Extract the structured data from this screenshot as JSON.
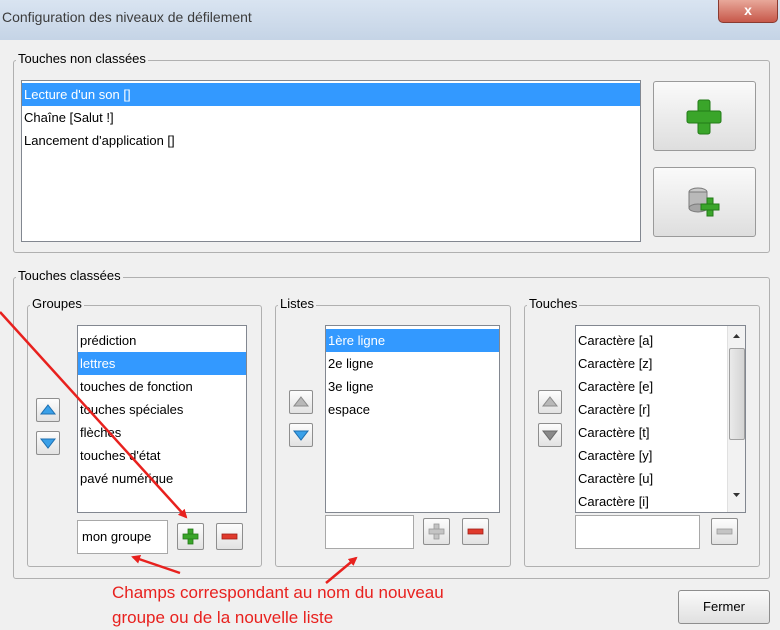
{
  "window": {
    "title": "Configuration des niveaux de défilement",
    "close_label": "x"
  },
  "unclassified": {
    "label": "Touches non classées",
    "items": [
      {
        "label": "Lecture d'un son []",
        "selected": true
      },
      {
        "label": "Chaîne [Salut !]",
        "selected": false
      },
      {
        "label": "Lancement d'application []",
        "selected": false
      }
    ],
    "buttons": [
      {
        "icon": "green-plus-icon"
      },
      {
        "icon": "database-add-icon"
      }
    ]
  },
  "classified": {
    "label": "Touches classées",
    "groupes": {
      "label": "Groupes",
      "items": [
        {
          "label": "prédiction",
          "selected": false
        },
        {
          "label": "lettres",
          "selected": true
        },
        {
          "label": "touches de fonction",
          "selected": false
        },
        {
          "label": "touches spéciales",
          "selected": false
        },
        {
          "label": "flèches",
          "selected": false
        },
        {
          "label": "touches d'état",
          "selected": false
        },
        {
          "label": "pavé numérique",
          "selected": false
        }
      ],
      "input_value": "mon groupe"
    },
    "listes": {
      "label": "Listes",
      "items": [
        {
          "label": "1ère ligne",
          "selected": true
        },
        {
          "label": "2e ligne",
          "selected": false
        },
        {
          "label": "3e ligne",
          "selected": false
        },
        {
          "label": "espace",
          "selected": false
        }
      ],
      "input_value": ""
    },
    "touches": {
      "label": "Touches",
      "items": [
        {
          "label": "Caractère [a]",
          "selected": false
        },
        {
          "label": "Caractère [z]",
          "selected": false
        },
        {
          "label": "Caractère [e]",
          "selected": false
        },
        {
          "label": "Caractère [r]",
          "selected": false
        },
        {
          "label": "Caractère [t]",
          "selected": false
        },
        {
          "label": "Caractère [y]",
          "selected": false
        },
        {
          "label": "Caractère [u]",
          "selected": false
        },
        {
          "label": "Caractère [i]",
          "selected": false
        }
      ],
      "input_value": ""
    }
  },
  "annotation": {
    "line1": "Champs correspondant au nom du nouveau",
    "line2": "groupe ou de la nouvelle liste",
    "color": "#e8211e"
  },
  "close_button_label": "Fermer",
  "colors": {
    "selection": "#3399ff",
    "plus_green": "#3aa52a",
    "minus_red": "#e03a2c"
  }
}
